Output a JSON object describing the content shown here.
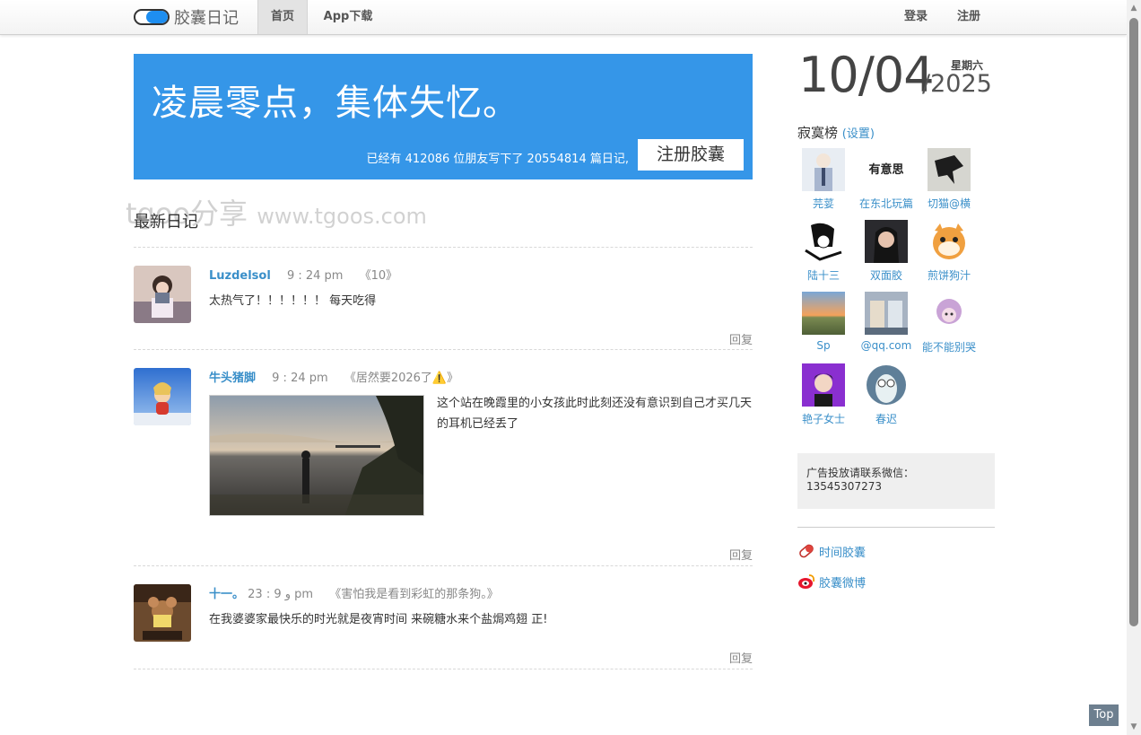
{
  "nav": {
    "logo_text": "胶囊日记",
    "home": "首页",
    "app": "App下载",
    "login": "登录",
    "register": "注册"
  },
  "banner": {
    "title": "凌晨零点，集体失忆。",
    "stats": "已经有 412086 位朋友写下了 20554814 篇日记,",
    "button": "注册胶囊"
  },
  "watermark": {
    "text": "tgoo分享",
    "domain": "www.tgoos.com"
  },
  "section_title": "最新日记",
  "entries": [
    {
      "author": "Luzdelsol",
      "time": "9 : 24 pm",
      "book": "《10》",
      "content": "太热气了！！！！！！ 每天吃得",
      "reply": "回复"
    },
    {
      "author": "牛头猪脚",
      "time": "9 : 24 pm",
      "book": "《居然要2026了⚠️》",
      "content": "这个站在晚霞里的小女孩此时此刻还没有意识到自己才买几天的耳机已经丢了",
      "reply": "回复"
    },
    {
      "author": "十一。",
      "time": "23 : 9 ﻭ     pm",
      "book": "《害怕我是看到彩虹的那条狗。》",
      "content": "在我婆婆家最快乐的时光就是夜宵时间 来碗糖水来个盐焗鸡翅 正!",
      "reply": "回复"
    }
  ],
  "date": {
    "day": "10/04",
    "year": "/2025",
    "weekday": "星期六"
  },
  "lonely": {
    "title": "寂寞榜",
    "settings": "(设置)",
    "friends": [
      {
        "name": "芫荽"
      },
      {
        "name": "在东北玩篇",
        "avatar_text": "有意思"
      },
      {
        "name": "切猫@横"
      },
      {
        "name": "陆十三"
      },
      {
        "name": "双面胶"
      },
      {
        "name": "煎饼狗汁"
      },
      {
        "name": "Sp"
      },
      {
        "name": "@qq.com"
      },
      {
        "name": "能不能别哭"
      },
      {
        "name": "艳子女士"
      },
      {
        "name": "春迟"
      }
    ]
  },
  "ad": {
    "text": "广告投放请联系微信：13545307273"
  },
  "links": {
    "capsule": "时间胶囊",
    "weibo": "胶囊微博"
  },
  "top_button": "Top",
  "colors": {
    "brand_blue": "#3596e8",
    "link_blue": "#3a8fc9"
  }
}
